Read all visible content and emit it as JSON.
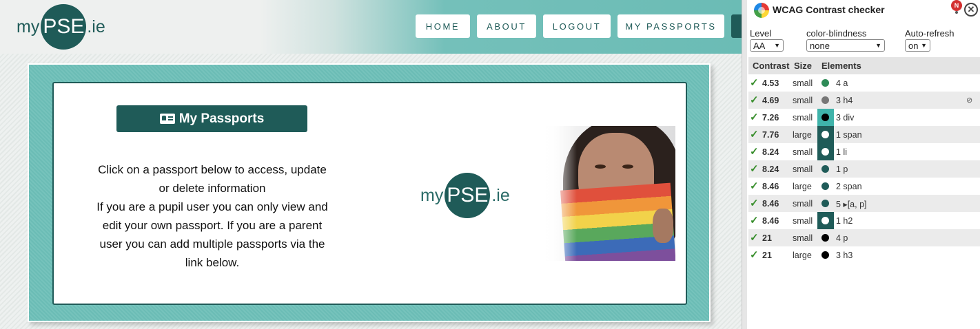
{
  "site": {
    "logo": {
      "my": "my",
      "pse": "PSE",
      "ie": ".ie"
    },
    "nav": [
      "HOME",
      "ABOUT",
      "LOGOUT",
      "MY PASSPORTS"
    ],
    "my_passports_button": "My Passports",
    "description": [
      "Click on a passport below to access, update",
      "or delete information",
      "If you are a pupil user you can only view and",
      "edit your own passport. If you are a parent",
      "user you can add multiple passports via the",
      "link below."
    ],
    "colors": {
      "brand": "#1f5b58",
      "teal": "#6bbcb5"
    }
  },
  "extension": {
    "title": "WCAG Contrast checker",
    "badge": "N",
    "level_label": "Level",
    "level_value": "AA",
    "colorblind_label": "color-blindness",
    "colorblind_value": "none",
    "autorefresh_label": "Auto-refresh",
    "autorefresh_value": "on",
    "columns": [
      "Contrast",
      "Size",
      "Elements"
    ],
    "rows": [
      {
        "ratio": "4.53",
        "size": "small",
        "dot": "#2e8b57",
        "swatch": "",
        "elements": "4 a"
      },
      {
        "ratio": "4.69",
        "size": "small",
        "dot": "#777777",
        "swatch": "",
        "elements": "3 h4",
        "hidden_icon": true
      },
      {
        "ratio": "7.26",
        "size": "small",
        "dot": "#000000",
        "swatch": "#3fb3aa",
        "elements": "3 div"
      },
      {
        "ratio": "7.76",
        "size": "large",
        "dot": "#ffffff",
        "swatch": "#1f5b58",
        "elements": "1 span"
      },
      {
        "ratio": "8.24",
        "size": "small",
        "dot": "#ffffff",
        "swatch": "#1f5b58",
        "elements": "1 li"
      },
      {
        "ratio": "8.24",
        "size": "small",
        "dot": "#1f5b58",
        "swatch": "",
        "elements": "1 p"
      },
      {
        "ratio": "8.46",
        "size": "large",
        "dot": "#1f5b58",
        "swatch": "",
        "elements": "2 span"
      },
      {
        "ratio": "8.46",
        "size": "small",
        "dot": "#1f5b58",
        "swatch": "",
        "elements": "5 ▸[a, p]"
      },
      {
        "ratio": "8.46",
        "size": "small",
        "dot": "#ffffff",
        "swatch": "#1f5b58",
        "elements": "1 h2"
      },
      {
        "ratio": "21",
        "size": "small",
        "dot": "#000000",
        "swatch": "",
        "elements": "4 p"
      },
      {
        "ratio": "21",
        "size": "large",
        "dot": "#000000",
        "swatch": "",
        "elements": "3 h3"
      }
    ],
    "icons": {
      "check": "check-icon",
      "eye": "eye-off-icon",
      "close": "close-icon"
    }
  }
}
